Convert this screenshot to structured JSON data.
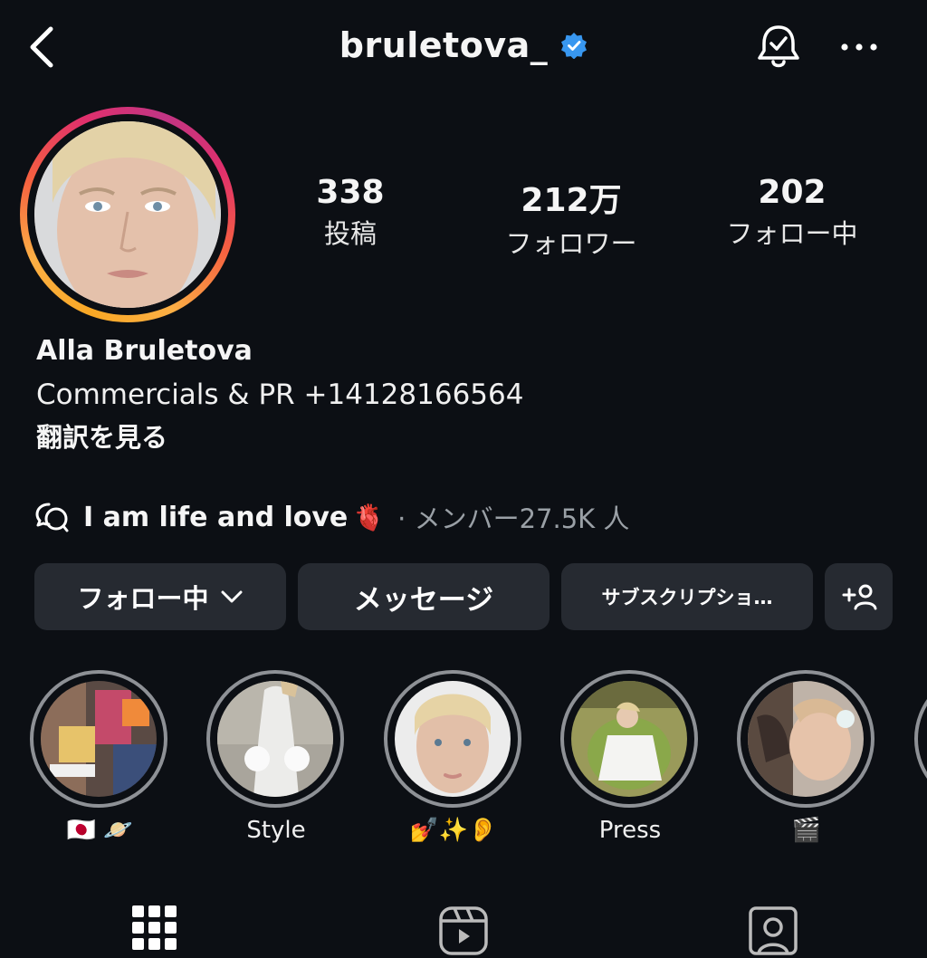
{
  "header": {
    "username": "bruletova_"
  },
  "profile": {
    "stats": [
      {
        "value": "338",
        "label": "投稿"
      },
      {
        "value": "212万",
        "label": "フォロワー"
      },
      {
        "value": "202",
        "label": "フォロー中"
      }
    ],
    "name": "Alla Bruletova",
    "bio": "Commercials & PR +14128166564",
    "translate": "翻訳を見る"
  },
  "channel": {
    "name": "I am life and love",
    "heart": "🫀",
    "meta": "· メンバー27.5K 人"
  },
  "buttons": {
    "following": "フォロー中",
    "message": "メッセージ",
    "subscribe": "サブスクリプショ…"
  },
  "highlights": [
    {
      "label": "🇯🇵 🪐"
    },
    {
      "label": "Style"
    },
    {
      "label": "💅✨👂"
    },
    {
      "label": "Press"
    },
    {
      "label": "🎬"
    }
  ],
  "colors": {
    "background": "#0c0f14",
    "button": "#262a31",
    "verified": "#3897f0",
    "muted": "#9aa0a6"
  }
}
